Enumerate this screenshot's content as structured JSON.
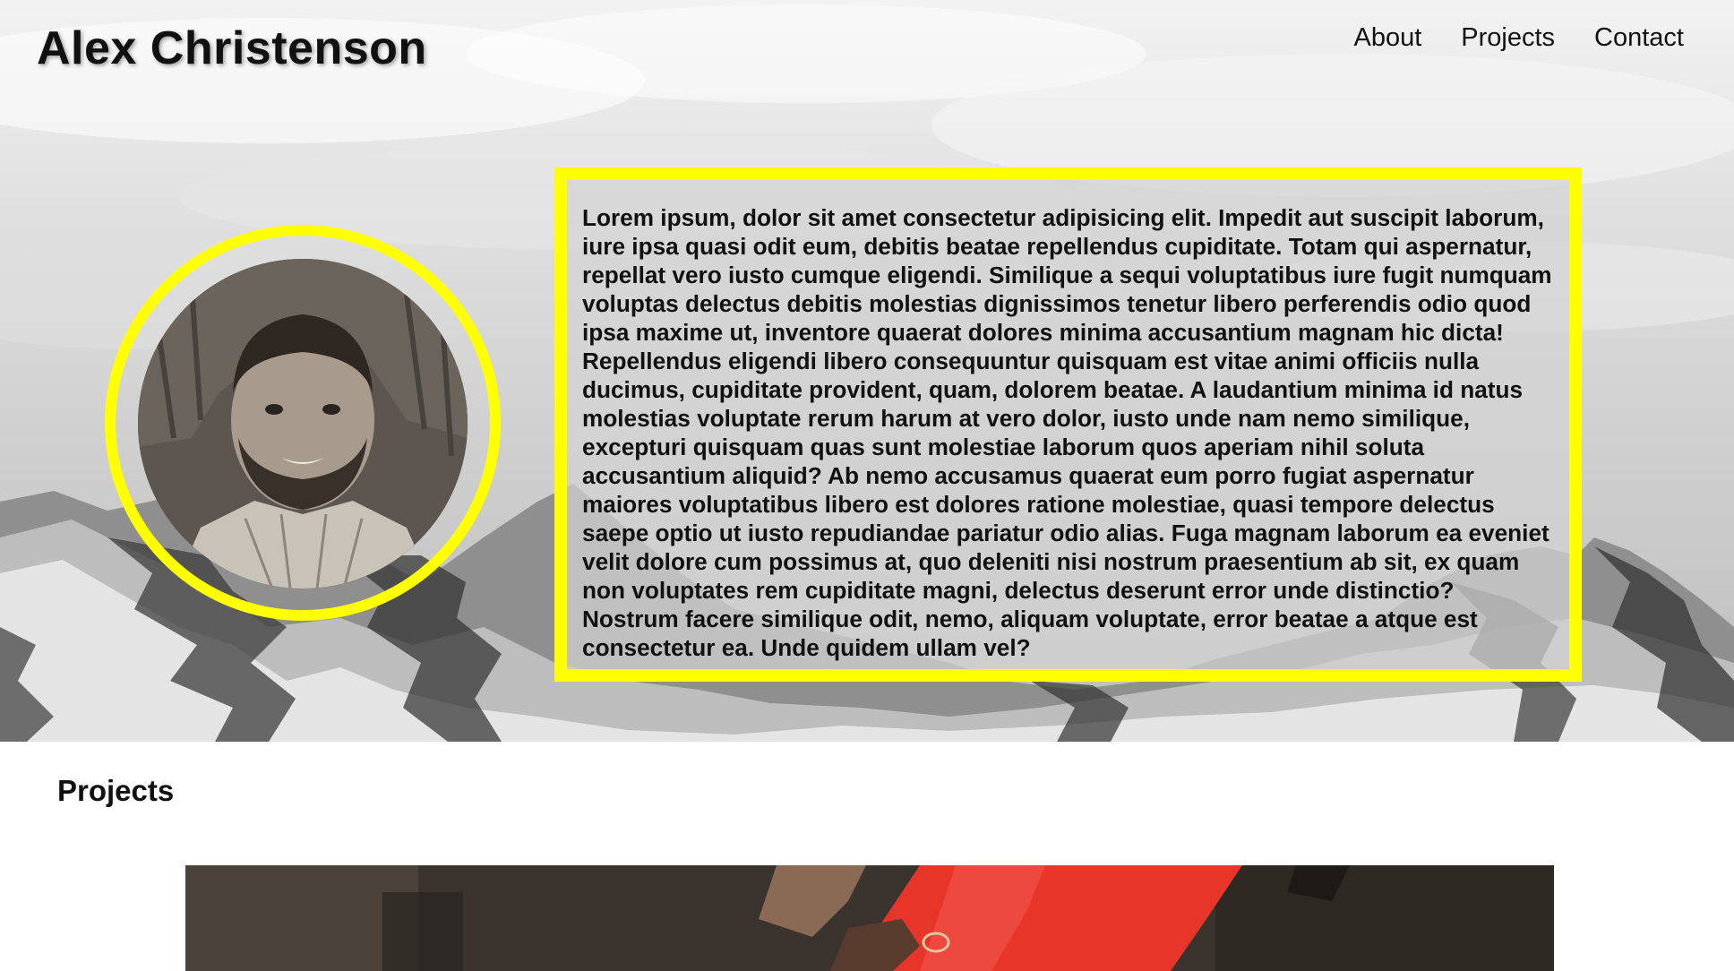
{
  "header": {
    "site_title": "Alex Christenson"
  },
  "nav": {
    "items": [
      "About",
      "Projects",
      "Contact"
    ]
  },
  "about": {
    "bio": "Lorem ipsum, dolor sit amet consectetur adipisicing elit. Impedit aut suscipit laborum, iure ipsa quasi odit eum, debitis beatae repellendus cupiditate. Totam qui aspernatur, repellat vero iusto cumque eligendi. Similique a sequi voluptatibus iure fugit numquam voluptas delectus debitis molestias dignissimos tenetur libero perferendis odio quod ipsa maxime ut, inventore quaerat dolores minima accusantium magnam hic dicta! Repellendus eligendi libero consequuntur quisquam est vitae animi officiis nulla ducimus, cupiditate provident, quam, dolorem beatae. A laudantium minima id natus molestias voluptate rerum harum at vero dolor, iusto unde nam nemo similique, excepturi quisquam quas sunt molestiae laborum quos aperiam nihil soluta accusantium aliquid? Ab nemo accusamus quaerat eum porro fugiat aspernatur maiores voluptatibus libero est dolores ratione molestiae, quasi tempore delectus saepe optio ut iusto repudiandae pariatur odio alias. Fuga magnam laborum ea eveniet velit dolore cum possimus at, quo deleniti nisi nostrum praesentium ab sit, ex quam non voluptates rem cupiditate magni, delectus deserunt error unde distinctio? Nostrum facere similique odit, nemo, aliquam voluptate, error beatae a atque est consectetur ea. Unde quidem ullam vel?"
  },
  "projects": {
    "heading": "Projects"
  },
  "colors": {
    "accent": "#ffff00",
    "text": "#111111",
    "project_red": "#e8352a"
  }
}
